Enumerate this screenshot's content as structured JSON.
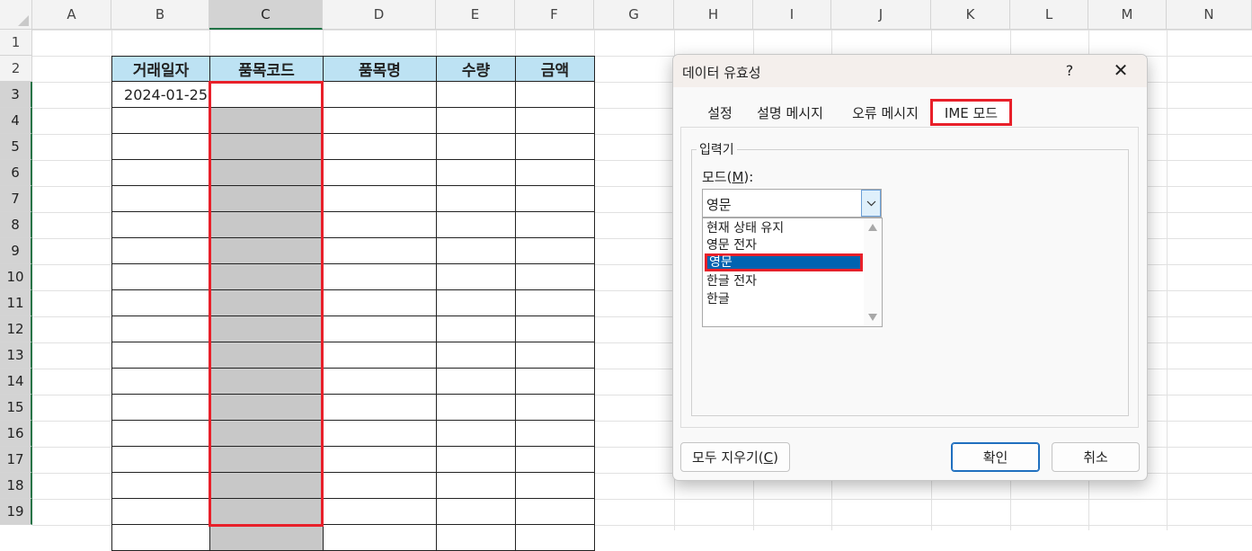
{
  "sheet": {
    "columns": [
      "A",
      "B",
      "C",
      "D",
      "E",
      "F",
      "G",
      "H",
      "I",
      "J",
      "K",
      "L",
      "M",
      "N"
    ],
    "rows": [
      "1",
      "2",
      "3",
      "4",
      "5",
      "6",
      "7",
      "8",
      "9",
      "10",
      "11",
      "12",
      "13",
      "14",
      "15",
      "16",
      "17",
      "18",
      "19"
    ],
    "selected_column": "C",
    "table_headers": [
      "거래일자",
      "품목코드",
      "품목명",
      "수량",
      "금액"
    ],
    "cell_B3": "2024-01-25",
    "accent_color": "#217346",
    "highlight_color": "#e8202a",
    "header_fill": "#bde2f3"
  },
  "dialog": {
    "title": "데이터 유효성",
    "help": "?",
    "close": "✕",
    "tabs": [
      "설정",
      "설명 메시지",
      "오류 메시지",
      "IME 모드"
    ],
    "active_tab": "IME 모드",
    "group_label": "입력기",
    "mode_label_prefix": "모드(",
    "mode_label_key": "M",
    "mode_label_suffix": "):",
    "mode_value": "영문",
    "options": [
      "현재 상태 유지",
      "영문 전자",
      "영문",
      "한글 전자",
      "한글"
    ],
    "selected_option": "영문",
    "clear_prefix": "모두 지우기(",
    "clear_key": "C",
    "clear_suffix": ")",
    "ok": "확인",
    "cancel": "취소"
  }
}
